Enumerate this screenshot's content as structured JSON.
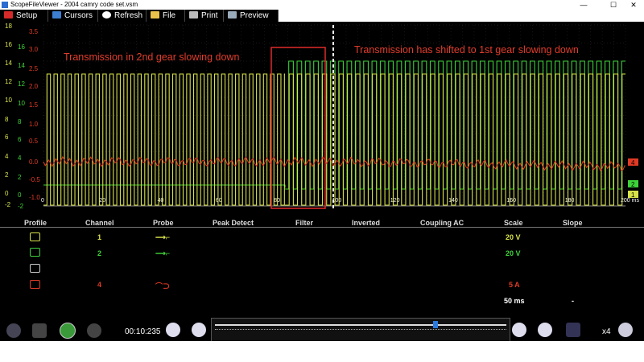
{
  "window": {
    "title": "ScopeFileViewer - 2004 camry code set.vsm",
    "minimize": "—",
    "maximize": "☐",
    "close": "✕"
  },
  "toolbar": {
    "buttons": [
      {
        "label": "Setup",
        "icon": "setup-icon"
      },
      {
        "label": "Cursors",
        "icon": "cursors-icon"
      },
      {
        "label": "Refresh",
        "icon": "refresh-icon"
      },
      {
        "label": "File",
        "icon": "folder-icon"
      },
      {
        "label": "Print",
        "icon": "print-icon"
      },
      {
        "label": "Preview",
        "icon": "preview-icon"
      }
    ]
  },
  "colors": {
    "ch1": "#d8e24a",
    "ch2": "#3ed23a",
    "ch4": "#e03a25",
    "background": "#000000",
    "annotation": "#e23c2c"
  },
  "scope": {
    "y_axis_1": [
      "18",
      "16",
      "14",
      "12",
      "10",
      "8",
      "6",
      "4",
      "2",
      "0",
      "-2"
    ],
    "y_axis_2": [
      "16",
      "14",
      "12",
      "10",
      "8",
      "6",
      "4",
      "2",
      "0",
      "-2"
    ],
    "y_axis_4": [
      "3.5",
      "3.0",
      "2.5",
      "2.0",
      "1.5",
      "1.0",
      "0.5",
      "0.0",
      "-0.5",
      "-1.0"
    ],
    "x_axis": [
      "0",
      "20",
      "40",
      "60",
      "80",
      "100",
      "120",
      "140",
      "160",
      "180",
      "200 ms"
    ],
    "channel_markers": [
      "4",
      "2",
      "1"
    ],
    "annotations": [
      "Transmission in 2nd gear slowing down",
      "Transmission has shifted to 1st gear slowing down"
    ]
  },
  "chart_data": {
    "type": "line",
    "xlabel": "",
    "xlim": [
      0,
      200
    ],
    "x_unit": "ms",
    "series": [
      {
        "name": "1",
        "low": 0,
        "high": 14.5
      },
      {
        "name": "2",
        "low": 0,
        "high": 14.5
      },
      {
        "name": "4",
        "mean": 0.0
      }
    ]
  },
  "table": {
    "headers": [
      "Profile",
      "Channel",
      "Probe",
      "Peak Detect",
      "Filter",
      "Inverted",
      "Coupling AC",
      "Scale",
      "Slope"
    ],
    "rows": [
      {
        "channel": "1",
        "scale": "20 V",
        "color": "#d8e24a",
        "probe": "voltage-probe-icon"
      },
      {
        "channel": "2",
        "scale": "20 V",
        "color": "#3ed23a",
        "probe": "voltage-probe-icon"
      },
      {
        "channel": "",
        "scale": "",
        "color": "#ffffff",
        "probe": ""
      },
      {
        "channel": "4",
        "scale": "5 A",
        "color": "#e03a25",
        "probe": "current-clamp-icon"
      }
    ],
    "timebase": "50 ms",
    "slope": "-"
  },
  "playback": {
    "time": "00:10:235",
    "zoom": "x4",
    "position": 0.76
  }
}
